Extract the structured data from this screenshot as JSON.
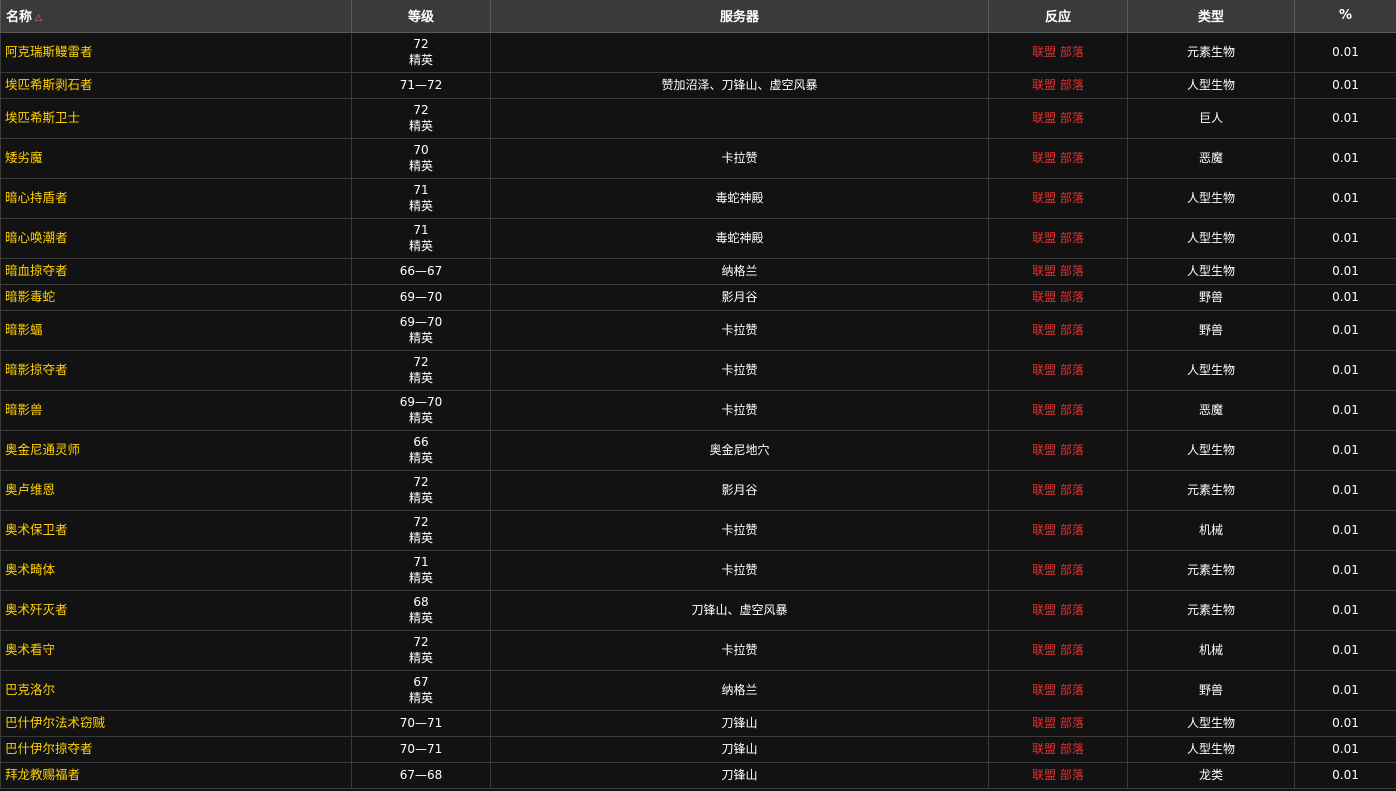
{
  "headers": {
    "name": "名称",
    "level": "等级",
    "zone": "服务器",
    "react": "反应",
    "type": "类型",
    "pct": "%"
  },
  "sort_indicator": "△",
  "colors": {
    "header_bg": "#3a3a3a",
    "row_bg": "#121212",
    "name_color": "#ffd100",
    "react_color": "#e23232"
  },
  "rows": [
    {
      "name": "阿克瑞斯鳗雷者",
      "level": "72",
      "elite": "精英",
      "zone": "",
      "react": "联盟 部落",
      "type": "元素生物",
      "pct": "0.01"
    },
    {
      "name": "埃匹希斯剥石者",
      "level": "71—72",
      "elite": "",
      "zone": "赞加沼泽、刀锋山、虚空风暴",
      "react": "联盟 部落",
      "type": "人型生物",
      "pct": "0.01"
    },
    {
      "name": "埃匹希斯卫士",
      "level": "72",
      "elite": "精英",
      "zone": "",
      "react": "联盟 部落",
      "type": "巨人",
      "pct": "0.01"
    },
    {
      "name": "矮劣魔",
      "level": "70",
      "elite": "精英",
      "zone": "卡拉赞",
      "react": "联盟 部落",
      "type": "恶魔",
      "pct": "0.01"
    },
    {
      "name": "暗心持盾者",
      "level": "71",
      "elite": "精英",
      "zone": "毒蛇神殿",
      "react": "联盟 部落",
      "type": "人型生物",
      "pct": "0.01"
    },
    {
      "name": "暗心唤潮者",
      "level": "71",
      "elite": "精英",
      "zone": "毒蛇神殿",
      "react": "联盟 部落",
      "type": "人型生物",
      "pct": "0.01"
    },
    {
      "name": "暗血掠夺者",
      "level": "66—67",
      "elite": "",
      "zone": "纳格兰",
      "react": "联盟 部落",
      "type": "人型生物",
      "pct": "0.01"
    },
    {
      "name": "暗影毒蛇",
      "level": "69—70",
      "elite": "",
      "zone": "影月谷",
      "react": "联盟 部落",
      "type": "野兽",
      "pct": "0.01"
    },
    {
      "name": "暗影蝠",
      "level": "69—70",
      "elite": "精英",
      "zone": "卡拉赞",
      "react": "联盟 部落",
      "type": "野兽",
      "pct": "0.01"
    },
    {
      "name": "暗影掠夺者",
      "level": "72",
      "elite": "精英",
      "zone": "卡拉赞",
      "react": "联盟 部落",
      "type": "人型生物",
      "pct": "0.01"
    },
    {
      "name": "暗影兽",
      "level": "69—70",
      "elite": "精英",
      "zone": "卡拉赞",
      "react": "联盟 部落",
      "type": "恶魔",
      "pct": "0.01"
    },
    {
      "name": "奥金尼通灵师",
      "level": "66",
      "elite": "精英",
      "zone": "奥金尼地穴",
      "react": "联盟 部落",
      "type": "人型生物",
      "pct": "0.01"
    },
    {
      "name": "奥卢维恩",
      "level": "72",
      "elite": "精英",
      "zone": "影月谷",
      "react": "联盟 部落",
      "type": "元素生物",
      "pct": "0.01"
    },
    {
      "name": "奥术保卫者",
      "level": "72",
      "elite": "精英",
      "zone": "卡拉赞",
      "react": "联盟 部落",
      "type": "机械",
      "pct": "0.01"
    },
    {
      "name": "奥术畸体",
      "level": "71",
      "elite": "精英",
      "zone": "卡拉赞",
      "react": "联盟 部落",
      "type": "元素生物",
      "pct": "0.01"
    },
    {
      "name": "奥术歼灭者",
      "level": "68",
      "elite": "精英",
      "zone": "刀锋山、虚空风暴",
      "react": "联盟 部落",
      "type": "元素生物",
      "pct": "0.01"
    },
    {
      "name": "奥术看守",
      "level": "72",
      "elite": "精英",
      "zone": "卡拉赞",
      "react": "联盟 部落",
      "type": "机械",
      "pct": "0.01"
    },
    {
      "name": "巴克洛尔",
      "level": "67",
      "elite": "精英",
      "zone": "纳格兰",
      "react": "联盟 部落",
      "type": "野兽",
      "pct": "0.01"
    },
    {
      "name": "巴什伊尔法术窃贼",
      "level": "70—71",
      "elite": "",
      "zone": "刀锋山",
      "react": "联盟 部落",
      "type": "人型生物",
      "pct": "0.01"
    },
    {
      "name": "巴什伊尔掠夺者",
      "level": "70—71",
      "elite": "",
      "zone": "刀锋山",
      "react": "联盟 部落",
      "type": "人型生物",
      "pct": "0.01"
    },
    {
      "name": "拜龙教赐福者",
      "level": "67—68",
      "elite": "",
      "zone": "刀锋山",
      "react": "联盟 部落",
      "type": "龙类",
      "pct": "0.01"
    }
  ]
}
